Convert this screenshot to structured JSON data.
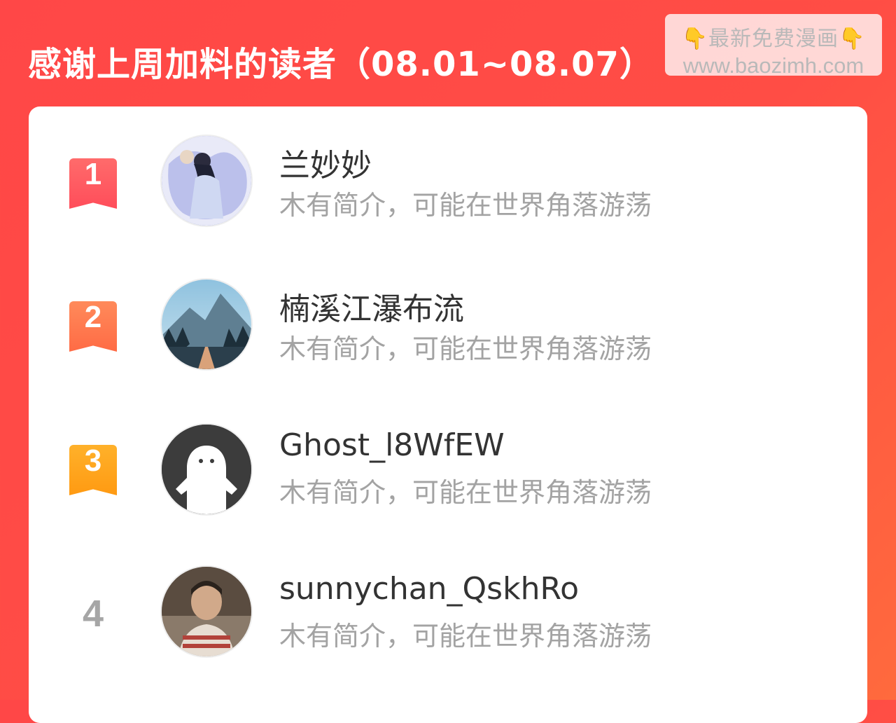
{
  "header": {
    "title": "感谢上周加料的读者（08.01~08.07）"
  },
  "watermark": {
    "line1": "最新免费漫画",
    "hand_icon": "👇",
    "line2": "www.baozimh.com"
  },
  "readers": [
    {
      "rank": "1",
      "name": "兰妙妙",
      "bio": "木有简介，可能在世界角落游荡",
      "badge_color": "#ff5a64",
      "avatar": "illustrated-woman-avatar"
    },
    {
      "rank": "2",
      "name": "楠溪江瀑布流",
      "bio": "木有简介，可能在世界角落游荡",
      "badge_color": "#ff7a4f",
      "avatar": "mountain-road-avatar"
    },
    {
      "rank": "3",
      "name": "Ghost_l8WfEW",
      "bio": "木有简介，可能在世界角落游荡",
      "badge_color": "#ffa21a",
      "avatar": "ghost-default-avatar"
    },
    {
      "rank": "4",
      "name": "sunnychan_QskhRo",
      "bio": "木有简介，可能在世界角落游荡",
      "avatar": "child-photo-avatar"
    }
  ]
}
